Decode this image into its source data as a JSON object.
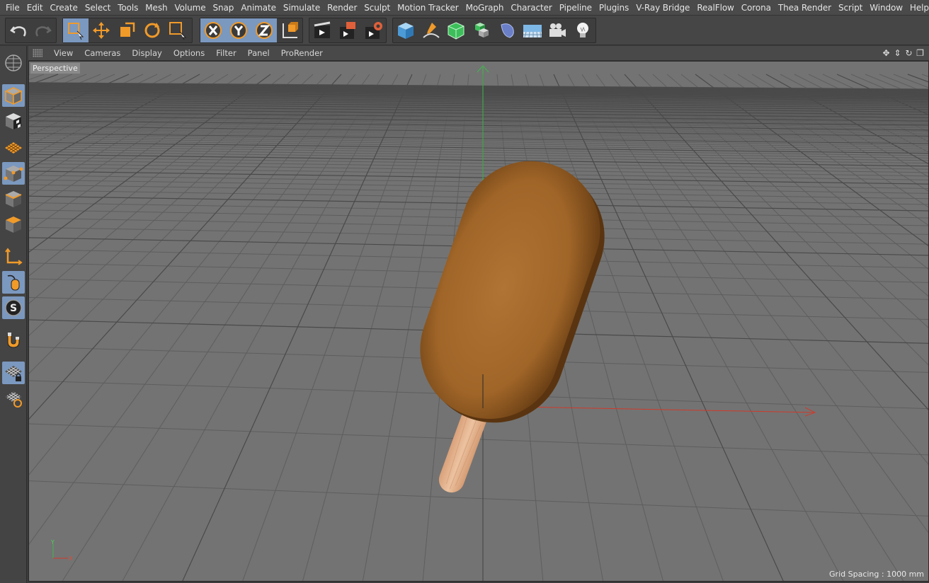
{
  "menu": [
    "File",
    "Edit",
    "Create",
    "Select",
    "Tools",
    "Mesh",
    "Volume",
    "Snap",
    "Animate",
    "Simulate",
    "Render",
    "Sculpt",
    "Motion Tracker",
    "MoGraph",
    "Character",
    "Pipeline",
    "Plugins",
    "V-Ray Bridge",
    "RealFlow",
    "Corona",
    "Thea Render",
    "Script",
    "Window",
    "Help"
  ],
  "viewport_menu": [
    "View",
    "Cameras",
    "Display",
    "Options",
    "Filter",
    "Panel",
    "ProRender"
  ],
  "viewport": {
    "label": "Perspective",
    "grid_spacing": "Grid Spacing : 1000 mm",
    "axis_x": "X",
    "axis_y": "Y"
  },
  "toolbar_icons": {
    "history": [
      "undo-icon",
      "redo-icon"
    ],
    "tools": [
      "live-selection-icon",
      "move-icon",
      "scale-icon",
      "rotate-icon",
      "recent-tool-icon"
    ],
    "axes": [
      "x-axis-lock-icon",
      "y-axis-lock-icon",
      "z-axis-lock-icon",
      "coordinate-system-icon"
    ],
    "render": [
      "render-view-icon",
      "render-picture-viewer-icon",
      "render-settings-icon"
    ],
    "objects": [
      "cube-icon",
      "pen-spline-icon",
      "subdivision-icon",
      "array-icon",
      "deformer-icon",
      "floor-icon",
      "camera-icon",
      "light-icon"
    ]
  },
  "left_icons": [
    "make-editable-icon",
    "model-mode-icon",
    "texture-mode-icon",
    "workplane-mode-icon",
    "points-mode-icon",
    "edges-mode-icon",
    "polygons-mode-icon",
    "axis-mode-icon",
    "tweak-mode-icon",
    "solo-icon",
    "snap-magnet-icon",
    "workplane-lock-icon",
    "workplane-align-icon"
  ],
  "colors": {
    "accent": "#f09a2a",
    "active": "#7b98bf",
    "viewport_bg": "#727272",
    "chocolate": "#a4692b",
    "stick": "#e3b08a",
    "x_axis": "#d03a2a",
    "y_axis": "#3fb84a"
  }
}
